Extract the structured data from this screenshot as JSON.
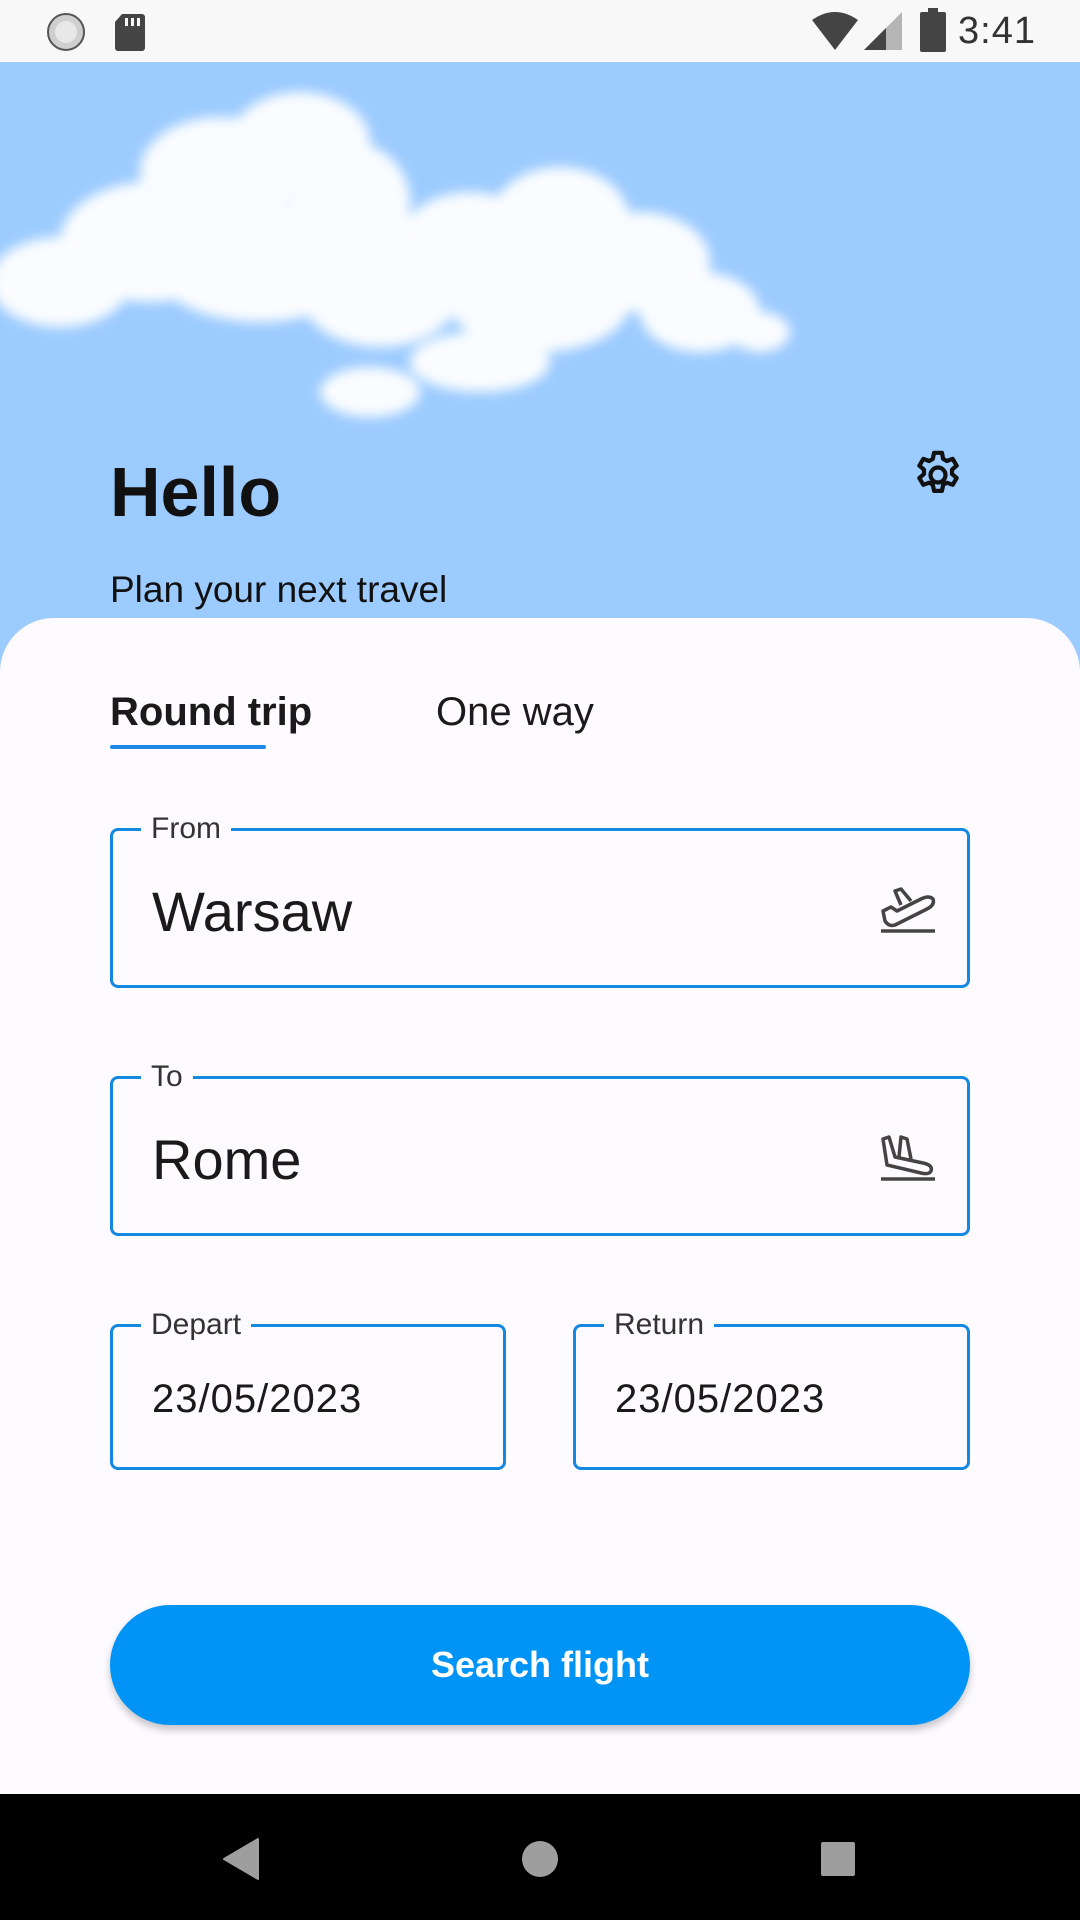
{
  "status_bar": {
    "time": "3:41",
    "icons": [
      "loading-icon",
      "sd-card-icon",
      "wifi-icon",
      "signal-icon",
      "battery-icon"
    ]
  },
  "header": {
    "greeting": "Hello",
    "subtitle": "Plan your next travel",
    "settings_icon": "gear-icon",
    "background_color": "#9ccbff"
  },
  "tabs": [
    {
      "label": "Round trip",
      "selected": true
    },
    {
      "label": "One way",
      "selected": false
    }
  ],
  "form": {
    "from": {
      "label": "From",
      "value": "Warsaw",
      "icon": "airplane-takeoff-icon"
    },
    "to": {
      "label": "To",
      "value": "Rome",
      "icon": "airplane-landing-icon"
    },
    "depart": {
      "label": "Depart",
      "value": "23/05/2023"
    },
    "return": {
      "label": "Return",
      "value": "23/05/2023"
    }
  },
  "search_button": {
    "label": "Search flight",
    "color": "#0094f7"
  },
  "accent_color": "#1588e1",
  "nav_bar": {
    "icons": [
      "back-icon",
      "home-icon",
      "recents-icon"
    ]
  }
}
